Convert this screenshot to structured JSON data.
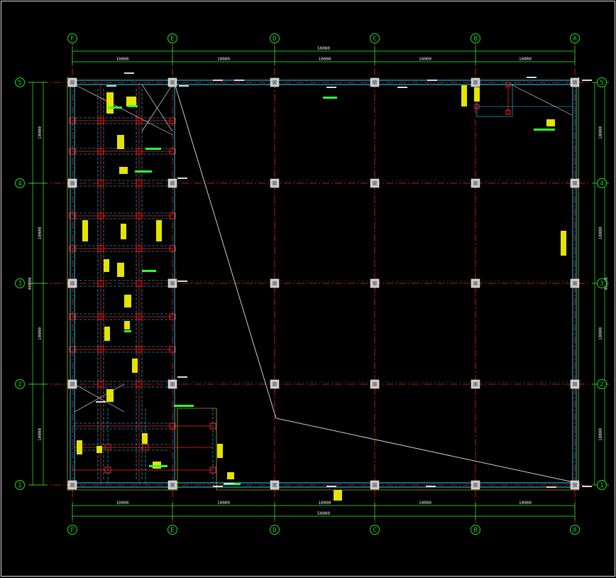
{
  "drawing": {
    "background": "#000000",
    "colors": {
      "axis_line": "#ff2020",
      "beam_line": "#20d8ff",
      "dim_line": "#20ff20",
      "bubble": "#20e020",
      "column": "#c8c8c8",
      "label_bg": "#f0f000",
      "border": "#e0e0e0"
    },
    "top_axes": [
      "F",
      "E",
      "D",
      "C",
      "B",
      "A"
    ],
    "bottom_axes": [
      "F",
      "E",
      "D",
      "C",
      "B",
      "A"
    ],
    "left_axes": [
      "5",
      "4",
      "3",
      "2",
      "1"
    ],
    "right_axes": [
      "5",
      "4",
      "3",
      "2",
      "1"
    ],
    "top_dims": [
      "10000",
      "10000",
      "10000",
      "10000",
      "10000"
    ],
    "top_total": "50000",
    "bottom_dims": [
      "10000",
      "10000",
      "10000",
      "10000",
      "10000"
    ],
    "bottom_total": "50000",
    "left_dims": [
      "10000",
      "10000",
      "10000",
      "10000"
    ],
    "left_total": "40000",
    "right_dims": [
      "10000",
      "10000",
      "10000",
      "10000"
    ],
    "right_total": "40000"
  }
}
